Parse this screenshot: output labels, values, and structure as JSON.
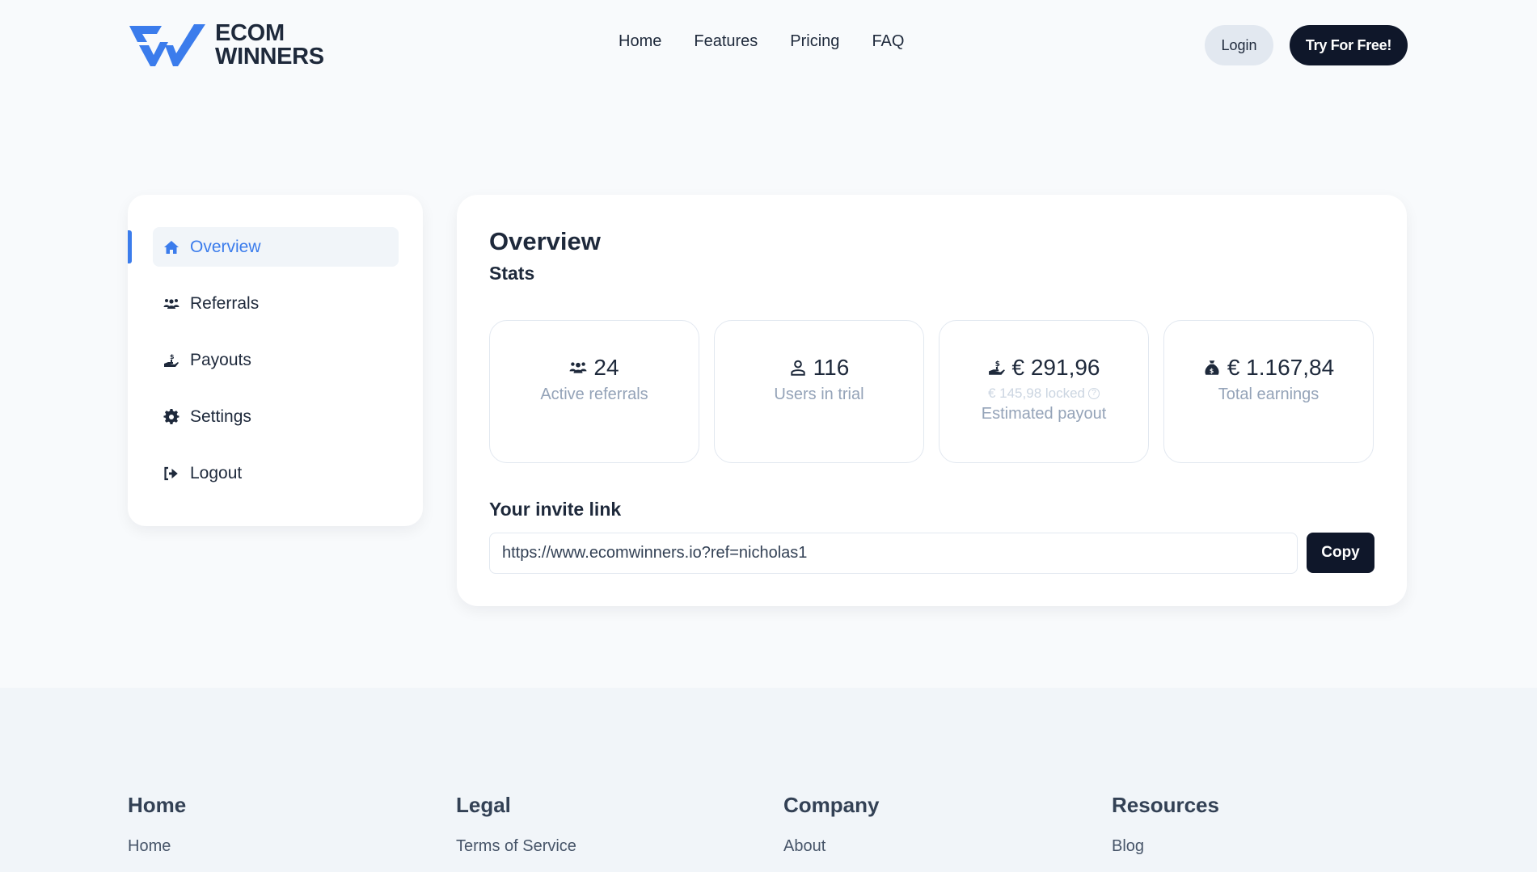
{
  "brand": {
    "name_line1": "ECOM",
    "name_line2": "WINNERS",
    "logo_icon": "ew-logo-icon",
    "accent_color": "#3b7cec"
  },
  "nav": {
    "links": [
      "Home",
      "Features",
      "Pricing",
      "FAQ"
    ],
    "login_label": "Login",
    "cta_label": "Try For Free!"
  },
  "sidebar": {
    "items": [
      {
        "label": "Overview",
        "icon": "home-icon",
        "active": true
      },
      {
        "label": "Referrals",
        "icon": "users-icon",
        "active": false
      },
      {
        "label": "Payouts",
        "icon": "hand-dollar-icon",
        "active": false
      },
      {
        "label": "Settings",
        "icon": "gear-icon",
        "active": false
      },
      {
        "label": "Logout",
        "icon": "logout-icon",
        "active": false
      }
    ]
  },
  "main": {
    "title": "Overview",
    "subtitle": "Stats",
    "stats": [
      {
        "icon": "users-icon",
        "value": "24",
        "label": "Active referrals"
      },
      {
        "icon": "user-icon",
        "value": "116",
        "label": "Users in trial"
      },
      {
        "icon": "hand-dollar-icon",
        "value": "€ 291,96",
        "locked": "€ 145,98 locked",
        "locked_help_icon": "question-circle-icon",
        "label": "Estimated payout"
      },
      {
        "icon": "money-bag-icon",
        "value": "€ 1.167,84",
        "label": "Total earnings"
      }
    ],
    "invite": {
      "label": "Your invite link",
      "value": "https://www.ecomwinners.io?ref=nicholas1",
      "copy_label": "Copy"
    }
  },
  "footer": {
    "columns": [
      {
        "title": "Home",
        "links": [
          "Home"
        ]
      },
      {
        "title": "Legal",
        "links": [
          "Terms of Service"
        ]
      },
      {
        "title": "Company",
        "links": [
          "About"
        ]
      },
      {
        "title": "Resources",
        "links": [
          "Blog"
        ]
      }
    ]
  }
}
